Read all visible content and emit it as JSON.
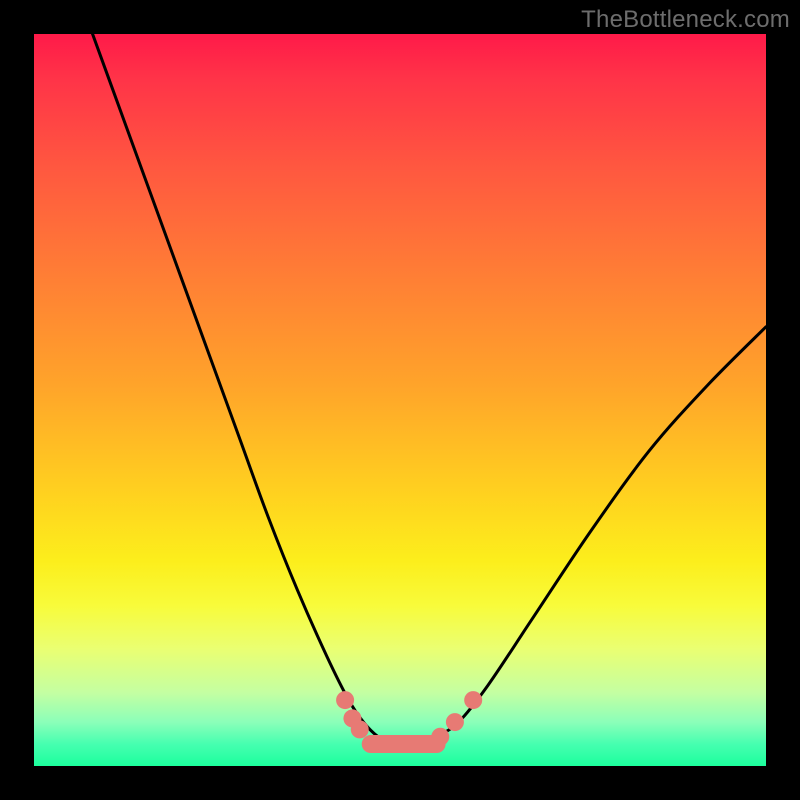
{
  "watermark": "TheBottleneck.com",
  "chart_data": {
    "type": "line",
    "title": "",
    "xlabel": "",
    "ylabel": "",
    "xlim": [
      0,
      100
    ],
    "ylim": [
      0,
      100
    ],
    "series": [
      {
        "name": "bottleneck-curve",
        "x": [
          8,
          12,
          16,
          20,
          24,
          28,
          32,
          36,
          40,
          43,
          45,
          47,
          49,
          51,
          53,
          55,
          58,
          62,
          68,
          76,
          84,
          92,
          100
        ],
        "y": [
          100,
          89,
          78,
          67,
          56,
          45,
          34,
          24,
          15,
          9,
          6,
          4,
          3,
          3,
          3,
          4,
          6,
          11,
          20,
          32,
          43,
          52,
          60
        ]
      }
    ],
    "markers": {
      "name": "highlight-dots",
      "color": "#e77a74",
      "points": [
        {
          "x": 42.5,
          "y": 9
        },
        {
          "x": 43.5,
          "y": 6.5
        },
        {
          "x": 44.5,
          "y": 5
        },
        {
          "x": 48,
          "y": 3
        },
        {
          "x": 52,
          "y": 3
        },
        {
          "x": 55.5,
          "y": 4
        },
        {
          "x": 57.5,
          "y": 6
        },
        {
          "x": 60,
          "y": 9
        }
      ],
      "pill": {
        "x1": 46,
        "x2": 55,
        "y": 3
      }
    },
    "background_gradient": {
      "top": "#ff1a49",
      "mid": "#fcee1c",
      "bottom": "#1cff9d"
    }
  }
}
